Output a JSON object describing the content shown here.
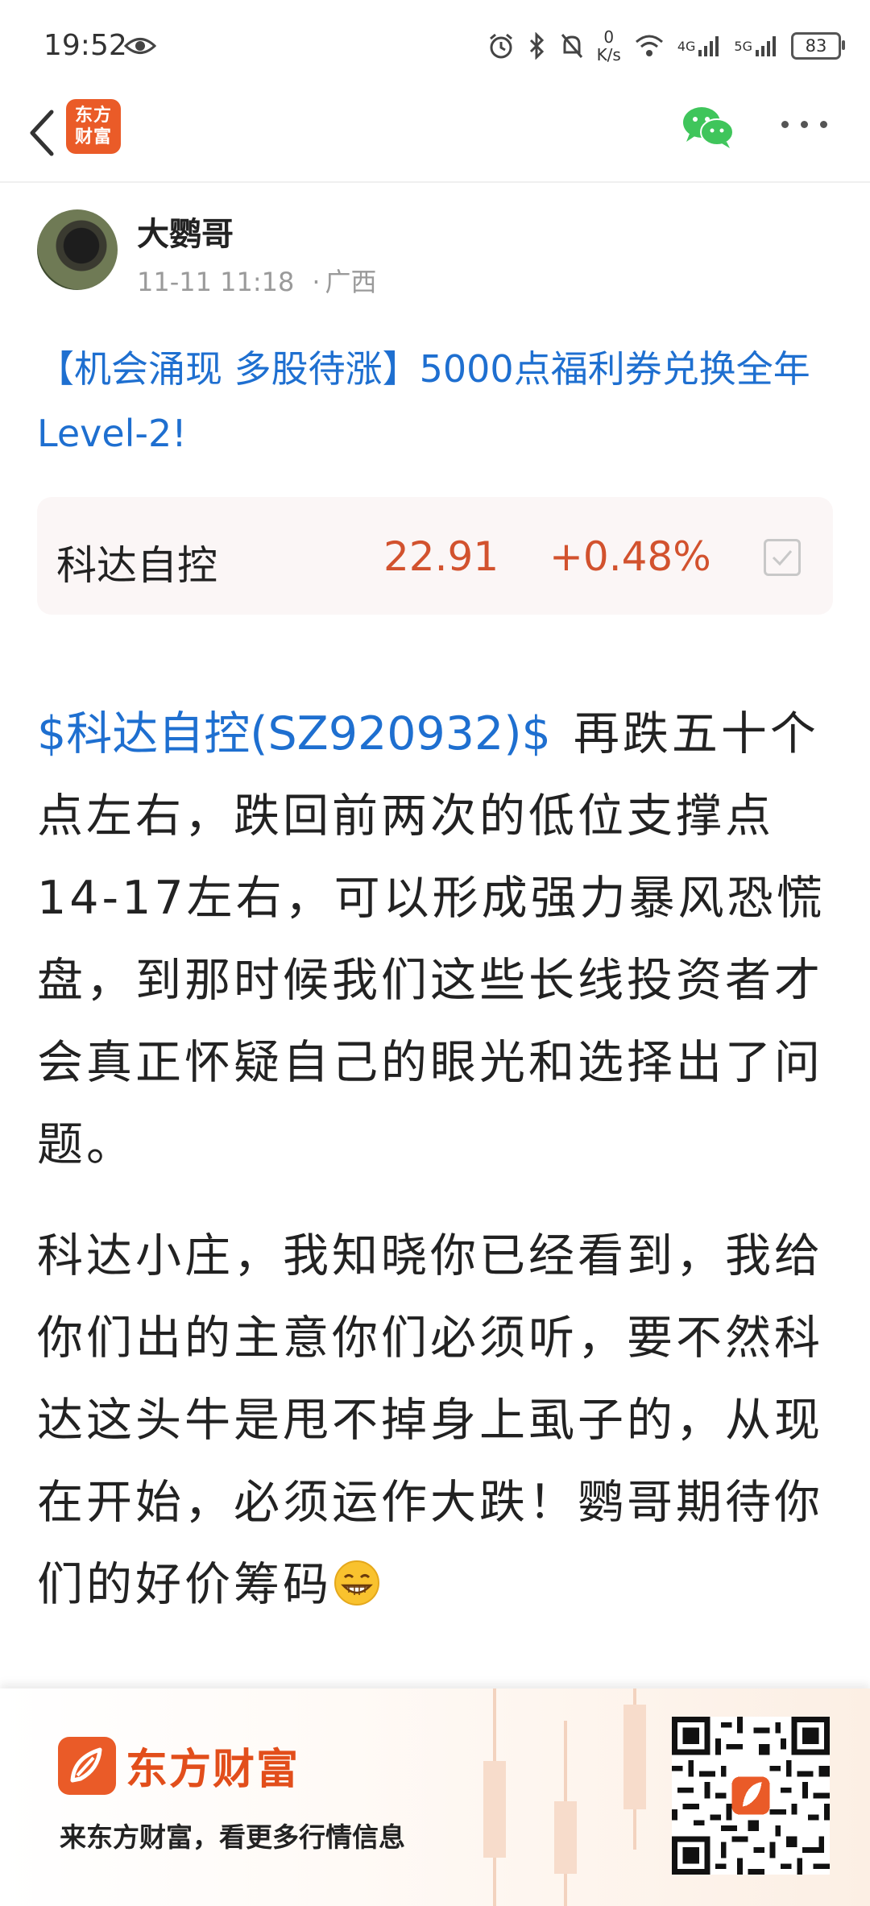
{
  "status_bar": {
    "time": "19:52",
    "net_speed_value": "0",
    "net_speed_unit": "K/s",
    "network_1": "4G",
    "network_2": "5G",
    "battery": "83"
  },
  "nav": {
    "brand_logo_line1": "东方",
    "brand_logo_line2": "财富"
  },
  "post": {
    "author_name": "大鹦哥",
    "datetime": "11-11 11:18",
    "location": "广西",
    "title": "【机会涌现 多股待涨】5000点福利券兑换全年Level-2!",
    "stock_card": {
      "name": "科达自控",
      "price": "22.91",
      "change": "+0.48%"
    },
    "body_link": "$科达自控(SZ920932)$",
    "paragraph1": "再跌五十个点左右，跌回前两次的低位支撑点14-17左右，可以形成强力暴风恐慌盘，到那时候我们这些长线投资者才会真正怀疑自己的眼光和选择出了问题。",
    "paragraph2": "科达小庄，我知晓你已经看到，我给你们出的主意你们必须听，要不然科达这头牛是甩不掉身上虱子的，从现在开始，必须运作大跌！鹦哥期待你们的好价筹码"
  },
  "footer": {
    "brand": "东方财富",
    "slogan": "来东方财富，看更多行情信息"
  },
  "colors": {
    "link_blue": "#1e6fd0",
    "price_red": "#d2522e",
    "brand_orange": "#ea5b28"
  }
}
